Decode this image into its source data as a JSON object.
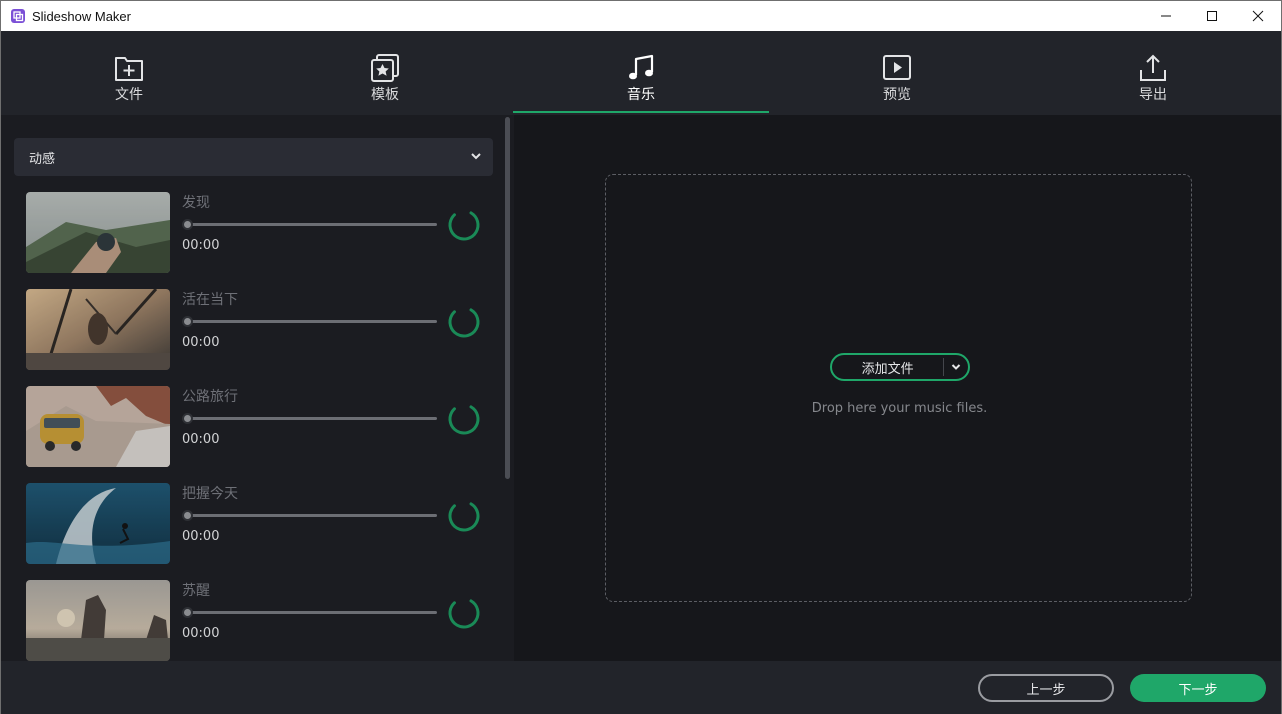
{
  "window": {
    "title": "Slideshow Maker"
  },
  "tabs": [
    {
      "label": "文件",
      "icon": "add-file-icon"
    },
    {
      "label": "模板",
      "icon": "template-star-icon"
    },
    {
      "label": "音乐",
      "icon": "music-note-icon",
      "active": true
    },
    {
      "label": "预览",
      "icon": "play-preview-icon"
    },
    {
      "label": "导出",
      "icon": "export-upload-icon"
    }
  ],
  "music": {
    "category": "动感",
    "tracks": [
      {
        "title": "发现",
        "time": "00:00"
      },
      {
        "title": "活在当下",
        "time": "00:00"
      },
      {
        "title": "公路旅行",
        "time": "00:00"
      },
      {
        "title": "把握今天",
        "time": "00:00"
      },
      {
        "title": "苏醒",
        "time": "00:00"
      }
    ]
  },
  "dropzone": {
    "add_button": "添加文件",
    "hint": "Drop here your music files."
  },
  "footer": {
    "prev": "上一步",
    "next": "下一步"
  },
  "colors": {
    "accent": "#1fa769",
    "background": "#17181c",
    "panel": "#1b1c21",
    "toolbar": "#22242a"
  }
}
